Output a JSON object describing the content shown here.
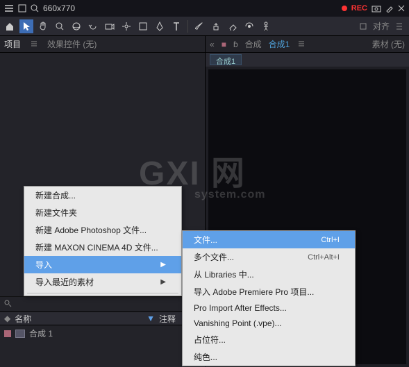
{
  "titlebar": {
    "dimensions": "660x770",
    "rec_label": "REC"
  },
  "toolbar_right": {
    "align_label": "对齐"
  },
  "left_panel": {
    "tab_project": "项目",
    "tab_effects": "效果控件 (无)",
    "col_name": "名称",
    "col_sort": "▼",
    "col_comment": "注释",
    "item1": "合成 1"
  },
  "right_panel": {
    "layer_prefix": "合成",
    "active_comp": "合成1",
    "footage": "素材 (无)",
    "subtab": "合成1"
  },
  "ctx1": {
    "new_comp": "新建合成...",
    "new_folder": "新建文件夹",
    "new_ps": "新建 Adobe Photoshop 文件...",
    "new_c4d": "新建 MAXON CINEMA 4D 文件...",
    "import": "导入",
    "import_recent": "导入最近的素材"
  },
  "ctx2": {
    "file": "文件...",
    "file_sc": "Ctrl+I",
    "multi": "多个文件...",
    "multi_sc": "Ctrl+Alt+I",
    "libraries": "从 Libraries 中...",
    "premiere": "导入 Adobe Premiere Pro 项目...",
    "proimport": "Pro Import After Effects...",
    "vanishing": "Vanishing Point (.vpe)...",
    "placeholder": "占位符...",
    "solid": "纯色..."
  },
  "watermark": {
    "main": "GXI 网",
    "sub": "system.com"
  }
}
